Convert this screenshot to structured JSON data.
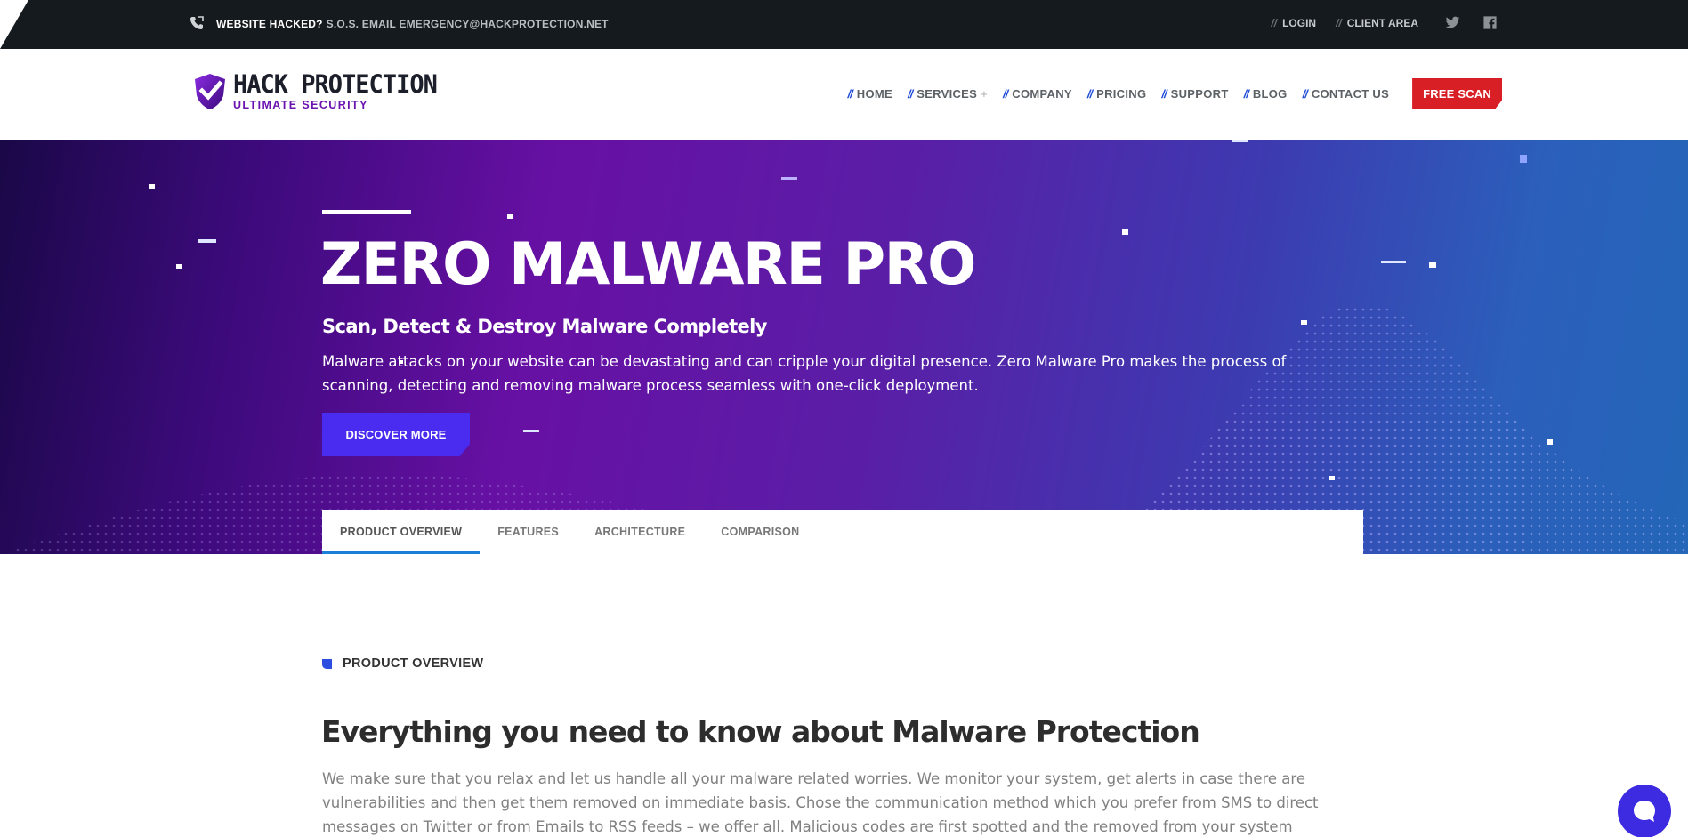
{
  "topbar": {
    "hacked_label": "WEBSITE HACKED?",
    "sos_text": "S.O.S. EMAIL EMERGENCY@HACKPROTECTION.NET",
    "links": [
      {
        "label": "LOGIN"
      },
      {
        "label": "CLIENT AREA"
      }
    ],
    "social": [
      "twitter-icon",
      "facebook-icon"
    ]
  },
  "header": {
    "logo_title": "HACK PROTECTION",
    "logo_subtitle": "ULTIMATE SECURITY",
    "nav": [
      {
        "label": "HOME"
      },
      {
        "label": "SERVICES"
      },
      {
        "label": "COMPANY"
      },
      {
        "label": "PRICING"
      },
      {
        "label": "SUPPORT"
      },
      {
        "label": "BLOG"
      },
      {
        "label": "CONTACT US"
      }
    ],
    "cta_label": "FREE SCAN",
    "colors": {
      "accent": "#d81f26",
      "nav_slash": "#1f4bd8",
      "brand_purple": "#6a13b0"
    }
  },
  "hero": {
    "title": "ZERO MALWARE PRO",
    "subtitle": "Scan, Detect & Destroy Malware Completely",
    "description": "Malware attacks on your website can be devastating and can cripple your digital presence. Zero Malware Pro makes the process of scanning, detecting and removing malware process seamless with one-click deployment.",
    "cta_label": "DISCOVER MORE"
  },
  "tabs": [
    {
      "label": "PRODUCT OVERVIEW",
      "active": true
    },
    {
      "label": "FEATURES"
    },
    {
      "label": "ARCHITECTURE"
    },
    {
      "label": "COMPARISON"
    }
  ],
  "content": {
    "section_label": "PRODUCT OVERVIEW",
    "title": "Everything you need to know about Malware Protection",
    "body": "We make sure that you relax and let us handle all your malware related worries. We monitor your system, get alerts in case there are vulnerabilities and then get them removed on immediate basis. Chose the communication method which you prefer from SMS to direct messages on Twitter or from Emails to RSS feeds – we offer all. Malicious codes are first spotted and the removed from your system"
  },
  "chat": {
    "icon": "chat-icon"
  }
}
